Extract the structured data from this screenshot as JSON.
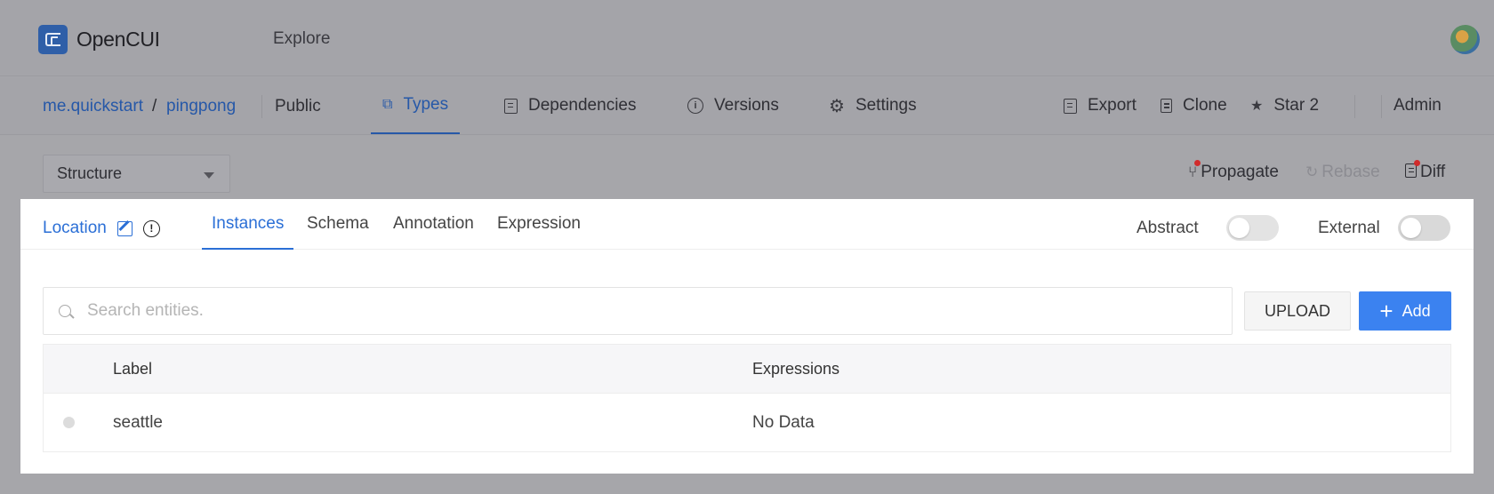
{
  "header": {
    "app_name": "OpenCUI",
    "explore_label": "Explore"
  },
  "subnav": {
    "breadcrumb_org": "me.quickstart",
    "breadcrumb_sep": "/",
    "breadcrumb_project": "pingpong",
    "visibility": "Public",
    "tabs": [
      {
        "label": "Types",
        "icon": "types-icon",
        "active": true
      },
      {
        "label": "Dependencies",
        "icon": "dependencies-icon",
        "active": false
      },
      {
        "label": "Versions",
        "icon": "info-icon",
        "active": false
      },
      {
        "label": "Settings",
        "icon": "gear-icon",
        "active": false
      }
    ],
    "actions": {
      "export": "Export",
      "clone": "Clone",
      "star": "Star 2",
      "admin": "Admin"
    }
  },
  "toolbar": {
    "structure_select": "Structure",
    "propagate": "Propagate",
    "rebase": "Rebase",
    "diff": "Diff"
  },
  "panel": {
    "type_name": "Location",
    "tabs": [
      {
        "label": "Instances",
        "active": true
      },
      {
        "label": "Schema",
        "active": false
      },
      {
        "label": "Annotation",
        "active": false
      },
      {
        "label": "Expression",
        "active": false
      }
    ],
    "abstract_label": "Abstract",
    "abstract_on": false,
    "external_label": "External",
    "external_on": false,
    "search_placeholder": "Search entities.",
    "upload_label": "UPLOAD",
    "add_label": "Add",
    "table": {
      "columns": [
        "Label",
        "Expressions"
      ],
      "rows": [
        {
          "label": "seattle",
          "expressions": "No Data"
        }
      ]
    }
  },
  "colors": {
    "accent": "#2b6fd6",
    "primary_button": "#3b82f0",
    "star": "#e3a106",
    "notification_dot": "#d12b2b"
  }
}
